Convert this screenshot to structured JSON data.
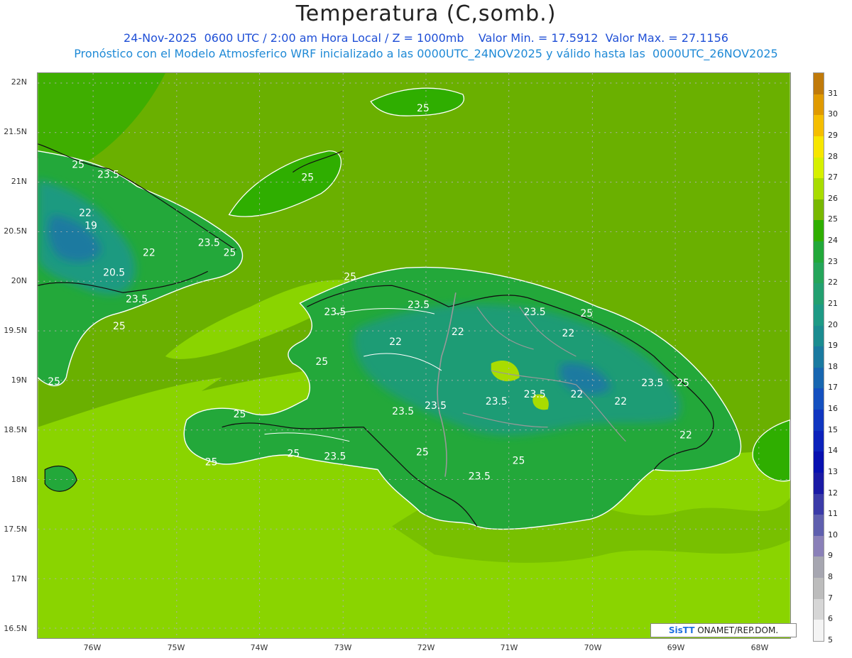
{
  "title": "Temperatura (C,somb.)",
  "subtitle_line1": "24-Nov-2025  0600 UTC / 2:00 am Hora Local / Z = 1000mb    Valor Min. = 17.5912  Valor Max. = 27.1156",
  "subtitle_line2": "Pronóstico con el Modelo Atmosferico WRF inicializado a las 0000UTC_24NOV2025 y válido hasta las  0000UTC_26NOV2025",
  "credit": {
    "brand": "SisTT",
    "text": " ONAMET/REP.DOM."
  },
  "lat_labels": [
    "22N",
    "21.5N",
    "21N",
    "20.5N",
    "20N",
    "19.5N",
    "19N",
    "18.5N",
    "18N",
    "17.5N",
    "17N",
    "16.5N"
  ],
  "lon_labels": [
    "76W",
    "75W",
    "74W",
    "73W",
    "72W",
    "71W",
    "70W",
    "69W",
    "68W"
  ],
  "contour_labels": [
    "25",
    "23.5",
    "22",
    "19",
    "20.5",
    "23.5",
    "25",
    "25",
    "22",
    "25",
    "25",
    "23.5",
    "25",
    "25",
    "23.5",
    "23.5",
    "22",
    "22",
    "22",
    "25",
    "25",
    "23.5",
    "23.5",
    "23.5",
    "23.5",
    "22",
    "22",
    "23.5",
    "25",
    "25",
    "23.5",
    "25",
    "23.5",
    "25",
    "25",
    "25",
    "23.5",
    "22"
  ],
  "colorbar": {
    "labels": [
      "31",
      "30",
      "29",
      "28",
      "27",
      "26",
      "25",
      "24",
      "23",
      "22",
      "21",
      "20",
      "19",
      "18",
      "17",
      "16",
      "15",
      "14",
      "13",
      "12",
      "11",
      "10",
      "9",
      "8",
      "7",
      "6",
      "5"
    ],
    "colors": [
      "#c07a0a",
      "#e09a00",
      "#f5be00",
      "#f7e600",
      "#d6f000",
      "#a8dc00",
      "#78b800",
      "#2fae00",
      "#22a83a",
      "#25a55a",
      "#23a070",
      "#1e9a85",
      "#1b8c90",
      "#1a7aa0",
      "#1766b0",
      "#1450bf",
      "#1036c0",
      "#0c22bb",
      "#0810b0",
      "#1a1aa5",
      "#3b3ba8",
      "#5f5fae",
      "#8a80b8",
      "#a6a6b0",
      "#bcbcbc",
      "#d6d6d6",
      "#f4f4f4"
    ]
  },
  "map_colors": {
    "sea_cool": "#6ab000",
    "sea_warm": "#8ad400",
    "sea_mid": "#a5d400",
    "land": "#23a83a",
    "land_high": "#1e9a80",
    "land_peak": "#1a7aa0"
  }
}
